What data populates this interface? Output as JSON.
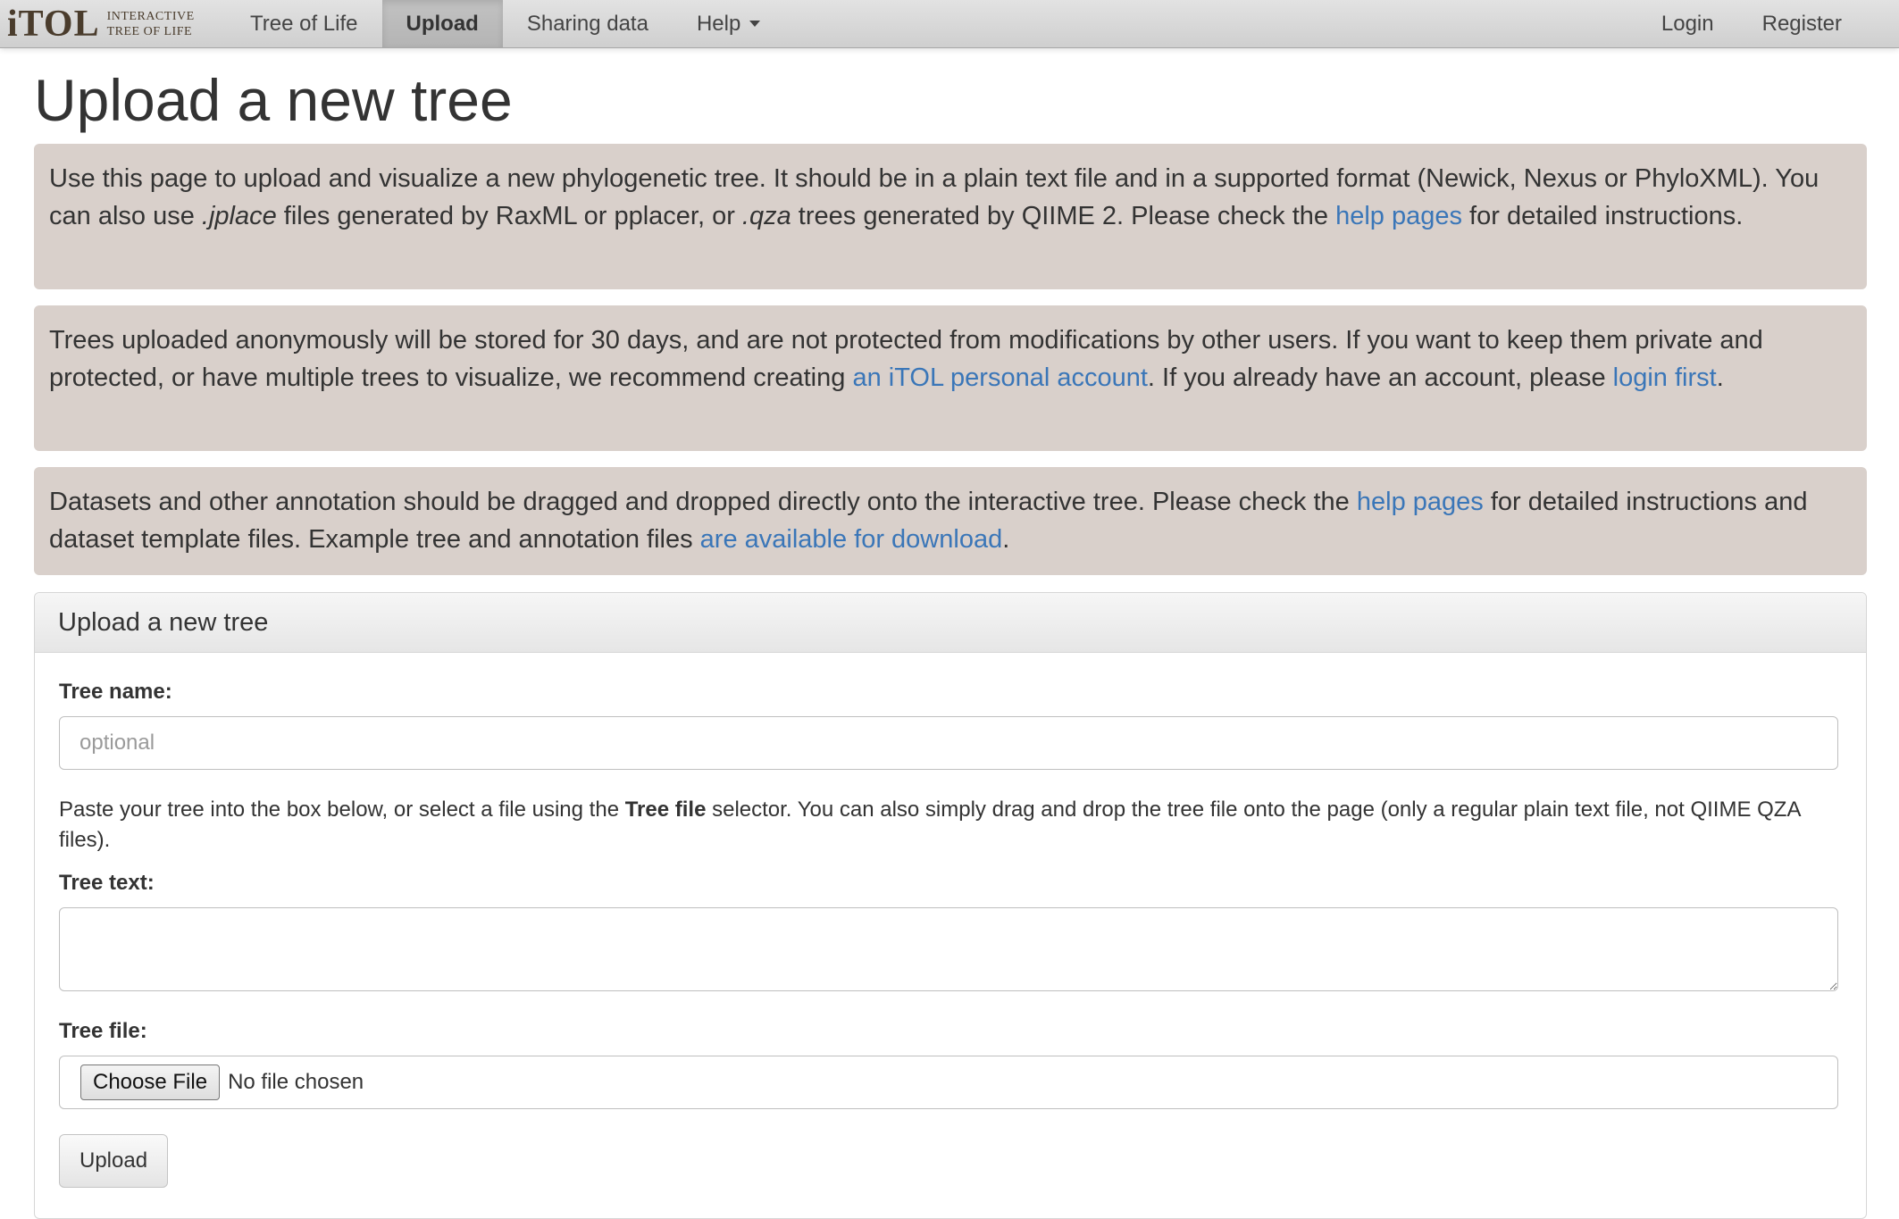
{
  "brand": {
    "mark": "iTOL",
    "subtitle_line1": "Interactive",
    "subtitle_line2": "Tree of Life"
  },
  "nav": {
    "items": [
      {
        "label": "Tree of Life",
        "active": false
      },
      {
        "label": "Upload",
        "active": true
      },
      {
        "label": "Sharing data",
        "active": false
      },
      {
        "label": "Help",
        "active": false,
        "has_dropdown": true
      }
    ],
    "right": [
      {
        "label": "Login"
      },
      {
        "label": "Register"
      }
    ]
  },
  "page": {
    "title": "Upload a new tree"
  },
  "notes": {
    "note1": {
      "t1": "Use this page to upload and visualize a new phylogenetic tree. It should be in a plain text file and in a supported format (Newick, Nexus or PhyloXML). You can also use ",
      "em1": ".jplace",
      "t2": " files generated by RaxML or pplacer, or ",
      "em2": ".qza",
      "t3": " trees generated by QIIME 2. Please check the ",
      "link": "help pages",
      "t4": " for detailed instructions."
    },
    "note2": {
      "t1": "Trees uploaded anonymously will be stored for 30 days, and are not protected from modifications by other users. If you want to keep them private and protected, or have multiple trees to visualize, we recommend creating ",
      "link1": "an iTOL personal account",
      "t2": ". If you already have an account, please ",
      "link2": "login first",
      "t3": "."
    },
    "note3": {
      "t1": "Datasets and other annotation should be dragged and dropped directly onto the interactive tree. Please check the ",
      "link1": "help pages",
      "t2": " for detailed instructions and dataset template files. Example tree and annotation files ",
      "link2": "are available for download",
      "t3": "."
    }
  },
  "form": {
    "heading": "Upload a new tree",
    "tree_name_label": "Tree name:",
    "tree_name_placeholder": "optional",
    "tree_name_value": "",
    "help_t1": "Paste your tree into the box below, or select a file using the ",
    "help_bold": "Tree file",
    "help_t2": " selector. You can also simply drag and drop the tree file onto the page (only a regular plain text file, not QIIME QZA files).",
    "tree_text_label": "Tree text:",
    "tree_text_value": "",
    "tree_file_label": "Tree file:",
    "choose_file_label": "Choose File",
    "no_file_text": "No file chosen",
    "upload_label": "Upload"
  },
  "colors": {
    "link": "#3a76b8",
    "note_bg": "#d9d0cb",
    "brand": "#4a3c2c"
  }
}
